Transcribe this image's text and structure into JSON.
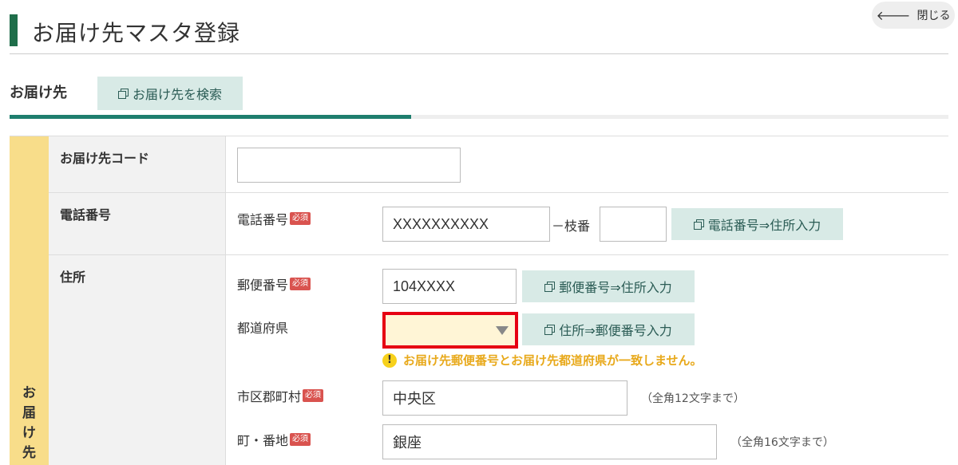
{
  "header": {
    "title": "お届け先マスタ登録",
    "close_label": "閉じる",
    "close_icon": "arrow-left-icon"
  },
  "section": {
    "label": "お届け先",
    "search_button": "お届け先を検索"
  },
  "side_band": {
    "chars": [
      "お",
      "届",
      "け",
      "先"
    ]
  },
  "rows": {
    "code": {
      "label": "お届け先コード",
      "value": ""
    },
    "phone": {
      "label": "電話番号",
      "field_label": "電話番号",
      "required": "必須",
      "value": "XXXXXXXXXX",
      "branch_label": "－枝番",
      "branch_value": "",
      "lookup_button": "電話番号⇒住所入力"
    },
    "address": {
      "label": "住所",
      "postal": {
        "field_label": "郵便番号",
        "required": "必須",
        "value": "104XXXX",
        "lookup_button": "郵便番号⇒住所入力"
      },
      "prefecture": {
        "field_label": "都道府県",
        "value": "",
        "lookup_button": "住所⇒郵便番号入力",
        "warning": "お届け先郵便番号とお届け先都道府県が一致しません。",
        "warning_icon": "!"
      },
      "city": {
        "field_label": "市区郡町村",
        "required": "必須",
        "value": "中央区",
        "hint": "（全角12文字まで）"
      },
      "street": {
        "field_label": "町・番地",
        "required": "必須",
        "value": "銀座",
        "hint": "（全角16文字まで）"
      }
    }
  },
  "colors": {
    "accent": "#1e7e6e",
    "side_band": "#f8dd8a",
    "error_border": "#e60012",
    "warning_text": "#e8a91b",
    "button_bg": "#d8eae6"
  }
}
